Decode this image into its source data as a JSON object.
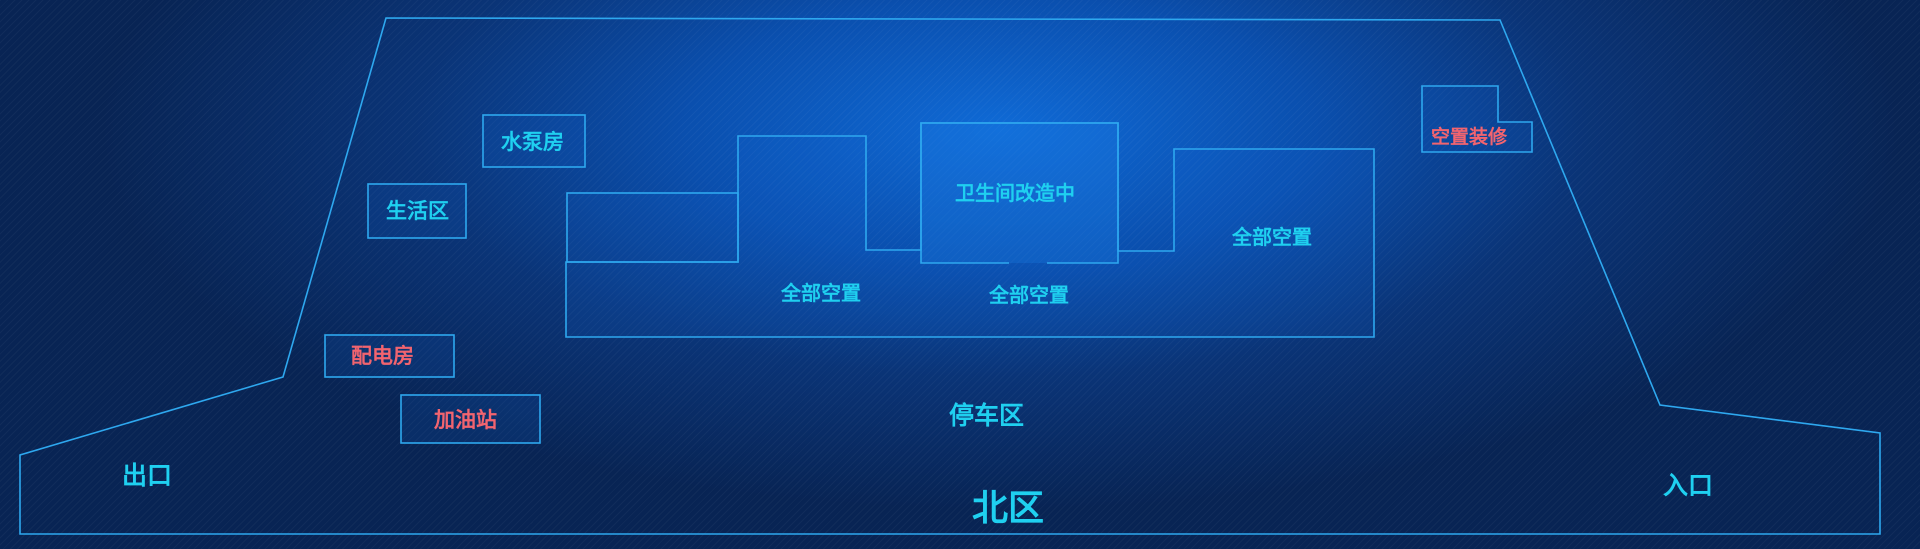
{
  "map": {
    "region_title": "北区",
    "entrance_label": "入口",
    "exit_label": "出口",
    "parking_label": "停车区",
    "facilities": {
      "pump_room": "水泵房",
      "living_area": "生活区",
      "power_room": "配电房",
      "gas_station": "加油站",
      "vacant_renovation": "空置装修"
    },
    "buildings": {
      "bathroom_renovation": "卫生间改造中",
      "vacant_left": "全部空置",
      "vacant_middle": "全部空置",
      "vacant_right": "全部空置"
    },
    "colors": {
      "line": "#2ea8ef",
      "label_normal": "#1fd0f0",
      "label_alert": "#f2646f",
      "background": "#0a3a86"
    }
  }
}
